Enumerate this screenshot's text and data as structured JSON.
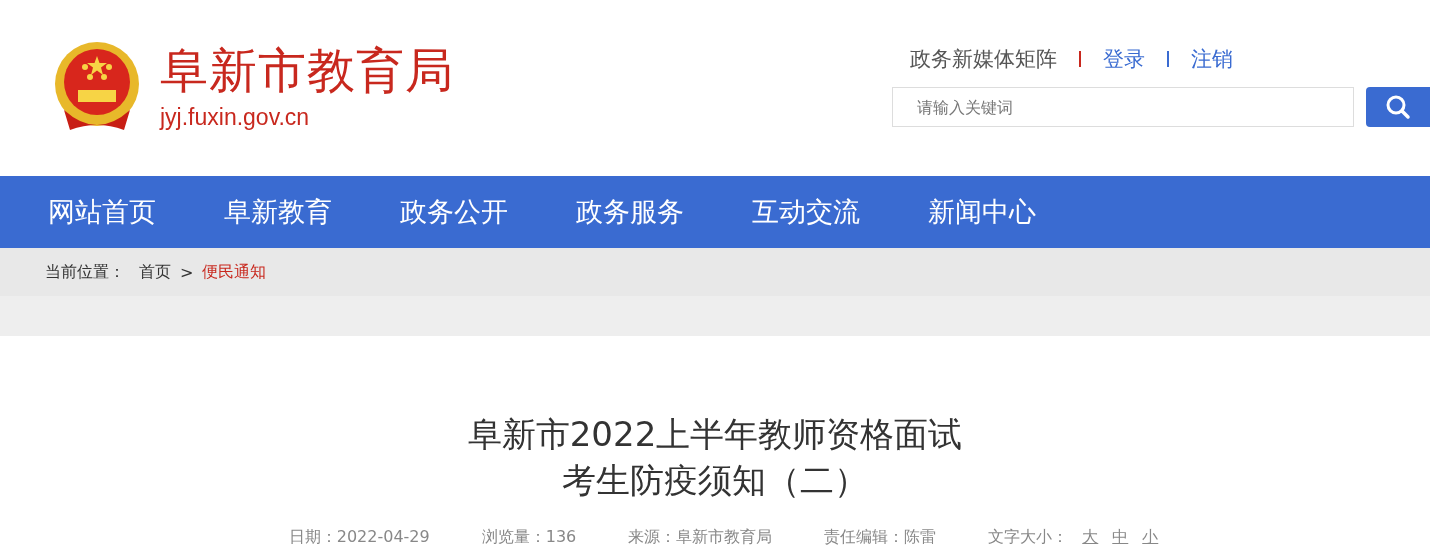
{
  "header": {
    "site_name": "阜新市教育局",
    "domain": "jyj.fuxin.gov.cn",
    "top_links": [
      {
        "label": "政务新媒体矩阵",
        "kind": "text"
      },
      {
        "label": "登录",
        "kind": "link"
      },
      {
        "label": "注销",
        "kind": "link"
      }
    ],
    "search": {
      "placeholder": "请输入关键词"
    }
  },
  "nav": [
    "网站首页",
    "阜新教育",
    "政务公开",
    "政务服务",
    "互动交流",
    "新闻中心"
  ],
  "breadcrumb": {
    "label": "当前位置：",
    "items": [
      {
        "label": "首页",
        "current": false
      },
      {
        "label": "便民通知",
        "current": true
      }
    ],
    "separator": ">"
  },
  "article": {
    "title_lines": [
      "阜新市2022上半年教师资格面试",
      "考生防疫须知（二）"
    ],
    "meta": [
      {
        "label": "日期：",
        "value": "2022-04-29"
      },
      {
        "label": "浏览量：",
        "value": "136"
      },
      {
        "label": "来源：",
        "value": "阜新市教育局"
      },
      {
        "label": "责任编辑：",
        "value": "陈雷"
      }
    ],
    "font_size": {
      "label": "文字大小：",
      "options": [
        "大",
        "中",
        "小"
      ]
    }
  }
}
